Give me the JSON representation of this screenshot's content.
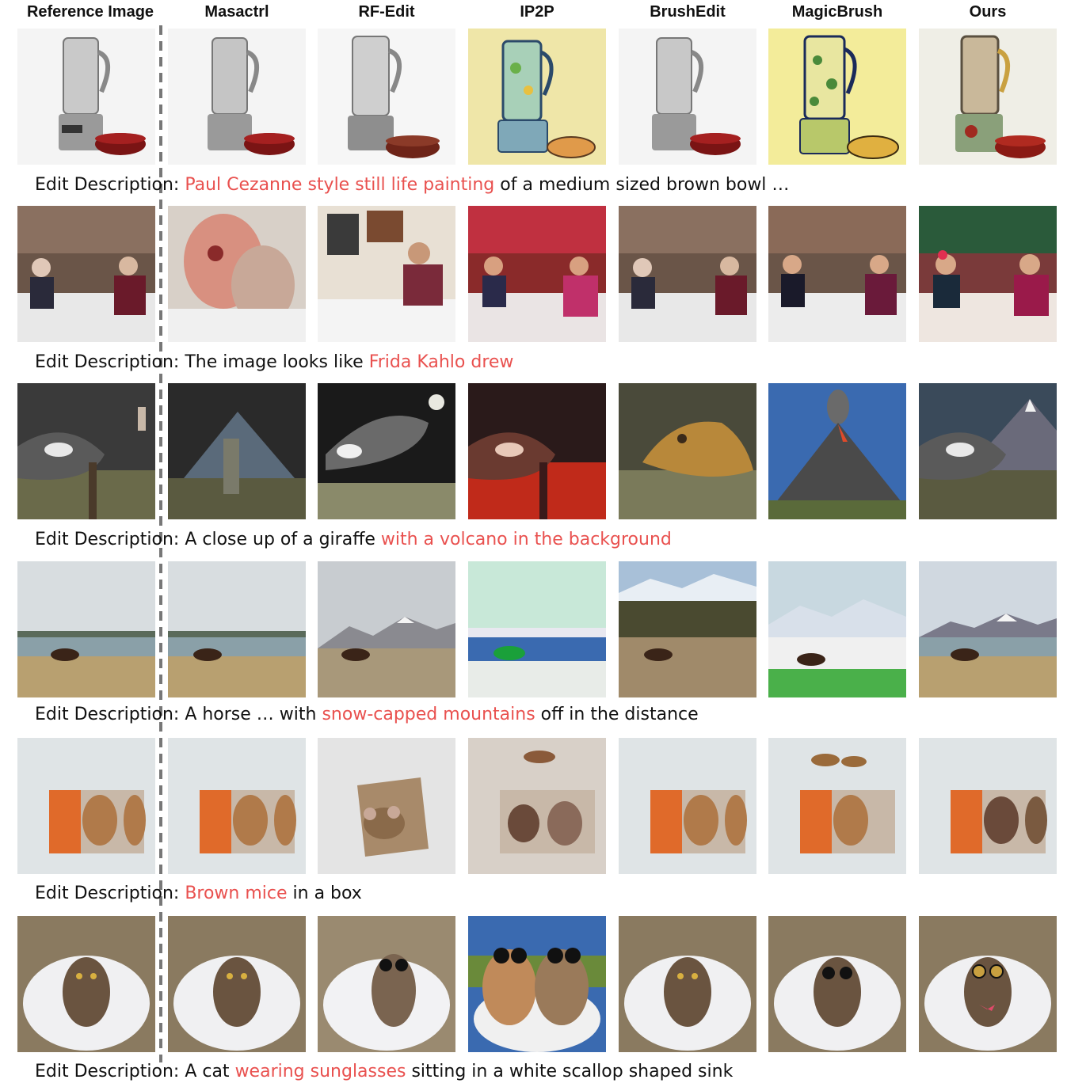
{
  "columns": [
    "Reference Image",
    "Masactrl",
    "RF-Edit",
    "IP2P",
    "BrushEdit",
    "MagicBrush",
    "Ours"
  ],
  "caption_prefix": "Edit Description:",
  "colors": {
    "highlight": "#e9514f",
    "text": "#111111",
    "divider": "#777777"
  },
  "rows": [
    {
      "subject": "blender",
      "caption": {
        "before": "",
        "highlight": "Paul Cezanne style still life painting",
        "after": " of a medium sized brown bowl …"
      },
      "cells": [
        {
          "label": "reference-image"
        },
        {
          "label": "masactrl-result"
        },
        {
          "label": "rf-edit-result"
        },
        {
          "label": "ip2p-result"
        },
        {
          "label": "brushedit-result"
        },
        {
          "label": "magicbrush-result"
        },
        {
          "label": "ours-result"
        }
      ]
    },
    {
      "subject": "restaurant",
      "caption": {
        "before": "The image looks like ",
        "highlight": "Frida Kahlo drew",
        "after": ""
      },
      "cells": [
        {
          "label": "reference-image"
        },
        {
          "label": "masactrl-result"
        },
        {
          "label": "rf-edit-result"
        },
        {
          "label": "ip2p-result"
        },
        {
          "label": "brushedit-result"
        },
        {
          "label": "magicbrush-result"
        },
        {
          "label": "ours-result"
        }
      ]
    },
    {
      "subject": "giraffe",
      "caption": {
        "before": "A close up of a giraffe ",
        "highlight": "with a volcano in the background",
        "after": ""
      },
      "cells": [
        {
          "label": "reference-image"
        },
        {
          "label": "masactrl-result"
        },
        {
          "label": "rf-edit-result"
        },
        {
          "label": "ip2p-result"
        },
        {
          "label": "brushedit-result"
        },
        {
          "label": "magicbrush-result"
        },
        {
          "label": "ours-result"
        }
      ]
    },
    {
      "subject": "horse",
      "caption": {
        "before": "A horse … with ",
        "highlight": "snow-capped mountains",
        "after": " off in the distance"
      },
      "cells": [
        {
          "label": "reference-image"
        },
        {
          "label": "masactrl-result"
        },
        {
          "label": "rf-edit-result"
        },
        {
          "label": "ip2p-result"
        },
        {
          "label": "brushedit-result"
        },
        {
          "label": "magicbrush-result"
        },
        {
          "label": "ours-result"
        }
      ]
    },
    {
      "subject": "mice",
      "caption": {
        "before": "",
        "highlight": "Brown mice",
        "after": " in a box"
      },
      "cells": [
        {
          "label": "reference-image"
        },
        {
          "label": "masactrl-result"
        },
        {
          "label": "rf-edit-result"
        },
        {
          "label": "ip2p-result"
        },
        {
          "label": "brushedit-result"
        },
        {
          "label": "magicbrush-result"
        },
        {
          "label": "ours-result"
        }
      ]
    },
    {
      "subject": "cat",
      "caption": {
        "before": "A cat ",
        "highlight": "wearing sunglasses",
        "after": " sitting in a white scallop shaped sink"
      },
      "cells": [
        {
          "label": "reference-image"
        },
        {
          "label": "masactrl-result"
        },
        {
          "label": "rf-edit-result"
        },
        {
          "label": "ip2p-result"
        },
        {
          "label": "brushedit-result"
        },
        {
          "label": "magicbrush-result"
        },
        {
          "label": "ours-result"
        }
      ]
    }
  ]
}
